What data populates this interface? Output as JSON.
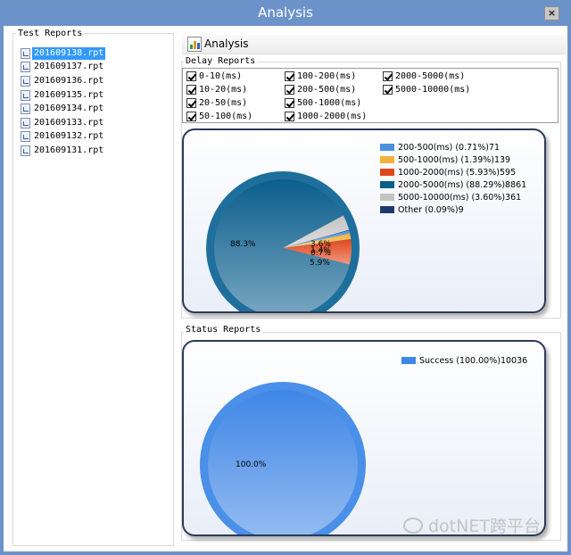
{
  "window": {
    "title": "Analysis",
    "close_glyph": "×"
  },
  "test_reports": {
    "label": "Test Reports",
    "files": [
      "201609138.rpt",
      "201609137.rpt",
      "201609136.rpt",
      "201609135.rpt",
      "201609134.rpt",
      "201609133.rpt",
      "201609132.rpt",
      "201609131.rpt"
    ],
    "selected_index": 0
  },
  "toolbar": {
    "analysis_label": "Analysis",
    "analysis_icon": "chart-document-icon"
  },
  "delay_reports": {
    "label": "Delay  Reports",
    "checkboxes": [
      {
        "label": "0-10(ms)",
        "checked": true
      },
      {
        "label": "10-20(ms)",
        "checked": true
      },
      {
        "label": "20-50(ms)",
        "checked": true
      },
      {
        "label": "50-100(ms)",
        "checked": true
      },
      {
        "label": "100-200(ms)",
        "checked": true
      },
      {
        "label": "200-500(ms)",
        "checked": true
      },
      {
        "label": "500-1000(ms)",
        "checked": true
      },
      {
        "label": "1000-2000(ms)",
        "checked": true
      },
      {
        "label": "2000-5000(ms)",
        "checked": true
      },
      {
        "label": "5000-10000(ms)",
        "checked": true
      }
    ]
  },
  "status_reports": {
    "label": "Status Reports"
  },
  "chart_data": [
    {
      "type": "pie",
      "title": "",
      "slices": [
        {
          "legend": "200-500(ms) (0.71%)71",
          "value": 71,
          "percent": 0.71,
          "color": "#4a8fe0"
        },
        {
          "legend": "500-1000(ms) (1.39%)139",
          "value": 139,
          "percent": 1.39,
          "color": "#f0b43c"
        },
        {
          "legend": "1000-2000(ms) (5.93%)595",
          "value": 595,
          "percent": 5.93,
          "color": "#e0471c"
        },
        {
          "legend": "2000-5000(ms) (88.29%)8861",
          "value": 8861,
          "percent": 88.29,
          "color": "#0b5e8c"
        },
        {
          "legend": "5000-10000(ms) (3.60%)361",
          "value": 361,
          "percent": 3.6,
          "color": "#c4c4c4"
        },
        {
          "legend": "Other (0.09%)9",
          "value": 9,
          "percent": 0.09,
          "color": "#1f3b6e"
        }
      ],
      "data_labels": [
        {
          "text": "88.3%",
          "slice": 3
        },
        {
          "text": "5.9%",
          "slice": 2
        },
        {
          "text": "3.6%",
          "slice": 4
        },
        {
          "text": "0.7%",
          "slice": 0
        },
        {
          "text": "1.4%",
          "slice": 1
        }
      ],
      "legend_position": "top-right"
    },
    {
      "type": "pie",
      "title": "",
      "slices": [
        {
          "legend": "Success (100.00%)10036",
          "value": 10036,
          "percent": 100.0,
          "color": "#3f86e6"
        }
      ],
      "data_labels": [
        {
          "text": "100.0%",
          "slice": 0
        }
      ],
      "legend_position": "top-right"
    }
  ],
  "watermark": {
    "text": "dotNET跨平台",
    "icon": "wechat-icon"
  }
}
